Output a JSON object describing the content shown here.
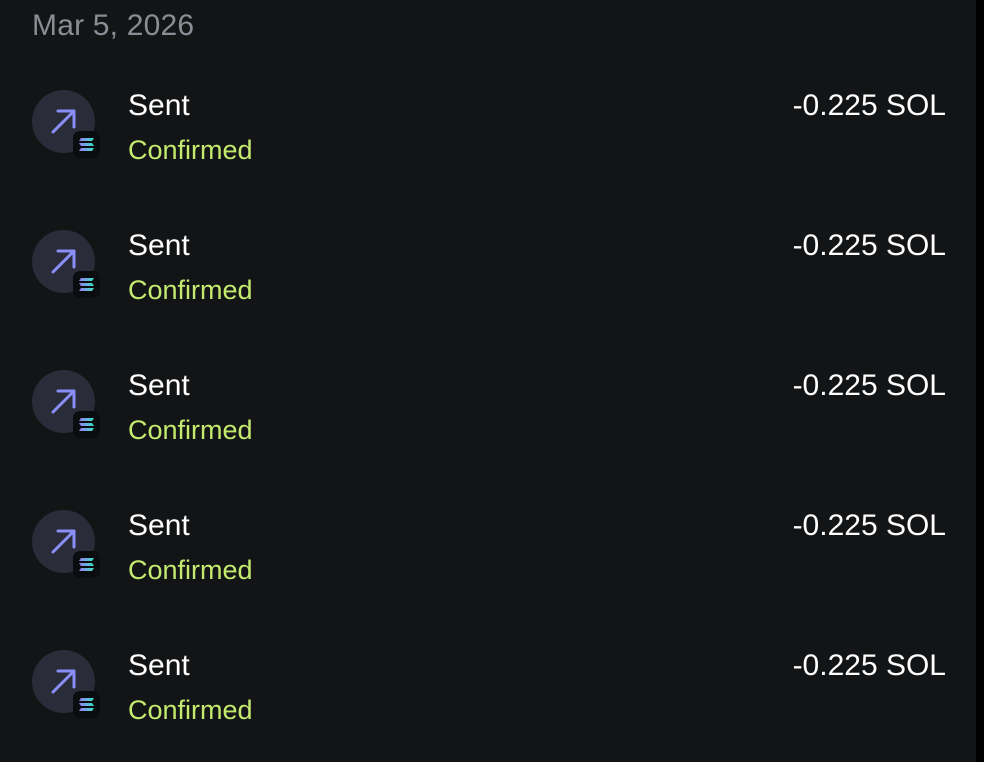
{
  "date_group": "Mar 5, 2026",
  "colors": {
    "background": "#131416",
    "date_text": "#8b8c94",
    "icon_circle": "#2a2c39",
    "arrow": "#8a8ff7",
    "status_confirmed": "#c3ea6e"
  },
  "transactions": [
    {
      "type": "Sent",
      "status": "Confirmed",
      "amount": "-0.225 SOL",
      "icon": "arrow-up-right-icon",
      "chain_icon": "solana-icon"
    },
    {
      "type": "Sent",
      "status": "Confirmed",
      "amount": "-0.225 SOL",
      "icon": "arrow-up-right-icon",
      "chain_icon": "solana-icon"
    },
    {
      "type": "Sent",
      "status": "Confirmed",
      "amount": "-0.225 SOL",
      "icon": "arrow-up-right-icon",
      "chain_icon": "solana-icon"
    },
    {
      "type": "Sent",
      "status": "Confirmed",
      "amount": "-0.225 SOL",
      "icon": "arrow-up-right-icon",
      "chain_icon": "solana-icon"
    },
    {
      "type": "Sent",
      "status": "Confirmed",
      "amount": "-0.225 SOL",
      "icon": "arrow-up-right-icon",
      "chain_icon": "solana-icon"
    }
  ]
}
